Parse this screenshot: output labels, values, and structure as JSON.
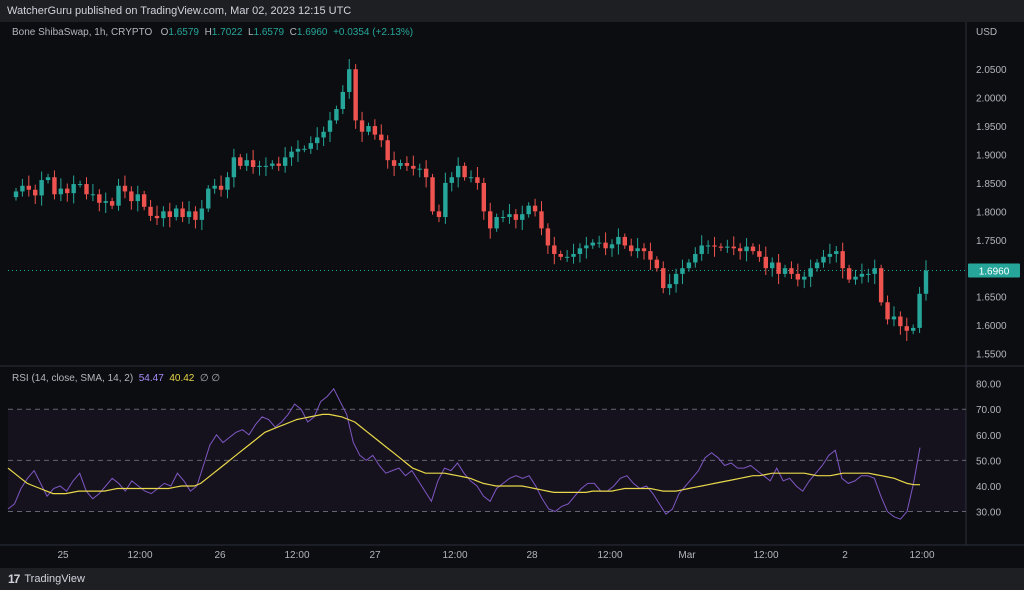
{
  "header": {
    "publisher": "WatcherGuru published on TradingView.com, Mar 02, 2023 12:15 UTC"
  },
  "legend": {
    "symbol": "Bone ShibaSwap, 1h, CRYPTO",
    "o_label": "O",
    "o": "1.6579",
    "h_label": "H",
    "h": "1.7022",
    "l_label": "L",
    "l": "1.6579",
    "c_label": "C",
    "c": "1.6960",
    "change": "+0.0354 (+2.13%)"
  },
  "rsi_legend": {
    "label": "RSI (14, close, SMA, 14, 2)",
    "rsi": "54.47",
    "sma": "40.42",
    "extra": "∅ ∅"
  },
  "footer": {
    "brand": "TradingView"
  },
  "colors": {
    "up": "#26a69a",
    "down": "#ef5350",
    "rsi": "#7e57c2",
    "rsi_ma": "#e8d84a",
    "price_tag": "#26a69a"
  },
  "chart_data": [
    {
      "type": "candlestick",
      "title": "Bone ShibaSwap, 1h, CRYPTO",
      "ylabel": "USD",
      "ylim": [
        1.535,
        2.075
      ],
      "y_ticks": [
        "2.0500",
        "2.0000",
        "1.9500",
        "1.9000",
        "1.8500",
        "1.8000",
        "1.7500",
        "1.7000",
        "1.6500",
        "1.6000",
        "1.5500"
      ],
      "x_ticks": [
        "25",
        "12:00",
        "26",
        "12:00",
        "27",
        "12:00",
        "28",
        "12:00",
        "Mar",
        "12:00",
        "2",
        "12:00"
      ],
      "last_price": "1.6960",
      "closes": [
        1.835,
        1.845,
        1.838,
        1.828,
        1.855,
        1.86,
        1.83,
        1.84,
        1.832,
        1.848,
        1.848,
        1.83,
        1.83,
        1.815,
        1.818,
        1.81,
        1.845,
        1.835,
        1.818,
        1.83,
        1.808,
        1.792,
        1.788,
        1.8,
        1.79,
        1.805,
        1.79,
        1.8,
        1.785,
        1.805,
        1.84,
        1.845,
        1.838,
        1.86,
        1.895,
        1.88,
        1.89,
        1.878,
        1.88,
        1.88,
        1.884,
        1.88,
        1.895,
        1.905,
        1.91,
        1.91,
        1.92,
        1.93,
        1.94,
        1.96,
        1.98,
        2.01,
        2.05,
        1.96,
        1.94,
        1.95,
        1.935,
        1.925,
        1.89,
        1.88,
        1.885,
        1.88,
        1.875,
        1.875,
        1.86,
        1.8,
        1.79,
        1.85,
        1.86,
        1.88,
        1.86,
        1.86,
        1.85,
        1.8,
        1.77,
        1.79,
        1.79,
        1.795,
        1.785,
        1.795,
        1.81,
        1.8,
        1.77,
        1.74,
        1.725,
        1.72,
        1.72,
        1.725,
        1.735,
        1.74,
        1.745,
        1.745,
        1.735,
        1.742,
        1.755,
        1.74,
        1.73,
        1.735,
        1.73,
        1.715,
        1.7,
        1.665,
        1.672,
        1.69,
        1.7,
        1.71,
        1.725,
        1.74,
        1.74,
        1.738,
        1.736,
        1.738,
        1.735,
        1.73,
        1.738,
        1.73,
        1.72,
        1.7,
        1.71,
        1.69,
        1.7,
        1.69,
        1.68,
        1.685,
        1.7,
        1.71,
        1.72,
        1.725,
        1.73,
        1.7,
        1.68,
        1.685,
        1.69,
        1.69,
        1.7,
        1.64,
        1.61,
        1.615,
        1.598,
        1.59,
        1.595,
        1.655,
        1.696
      ]
    },
    {
      "type": "line",
      "title": "RSI (14, close, SMA, 14, 2)",
      "ylim": [
        22,
        83
      ],
      "y_ticks": [
        "80.00",
        "70.00",
        "60.00",
        "50.00",
        "40.00",
        "30.00"
      ],
      "bands": [
        30,
        50,
        70
      ],
      "series": [
        {
          "name": "RSI",
          "values": [
            31,
            33,
            39,
            43,
            46,
            41,
            36,
            39,
            40,
            38,
            42,
            45,
            38,
            35,
            37,
            40,
            43,
            41,
            38,
            42,
            40,
            38,
            37,
            39,
            41,
            40,
            45,
            42,
            38,
            40,
            48,
            56,
            60,
            57,
            59,
            61,
            62,
            60,
            64,
            67,
            66,
            63,
            65,
            68,
            72,
            70,
            65,
            67,
            73,
            75,
            78,
            73,
            68,
            57,
            52,
            50,
            52,
            48,
            45,
            46,
            47,
            44,
            46,
            42,
            38,
            34,
            42,
            47,
            46,
            49,
            45,
            42,
            40,
            36,
            34,
            39,
            41,
            43,
            44,
            43,
            44,
            40,
            35,
            31,
            30,
            32,
            33,
            36,
            39,
            41,
            41,
            38,
            38,
            40,
            43,
            44,
            41,
            39,
            40,
            37,
            33,
            29,
            31,
            37,
            40,
            43,
            46,
            51,
            53,
            51,
            48,
            49,
            47,
            47,
            48,
            46,
            44,
            42,
            47,
            42,
            43,
            40,
            38,
            42,
            45,
            48,
            52,
            54,
            43,
            41,
            42,
            44,
            44,
            43,
            36,
            30,
            28,
            27,
            30,
            41,
            55
          ]
        },
        {
          "name": "SMA",
          "values": [
            47,
            45,
            43,
            41,
            40,
            39,
            38,
            37,
            37,
            37,
            37.5,
            38,
            38,
            38,
            38,
            38,
            38.5,
            39,
            39,
            39,
            39,
            39,
            39,
            39,
            39,
            39,
            39.5,
            40,
            40,
            40,
            41,
            43,
            45,
            47,
            49,
            51,
            53,
            55,
            57,
            59,
            61,
            62,
            63,
            64,
            65,
            66,
            66.5,
            67,
            67.5,
            68,
            68,
            67.5,
            67,
            66,
            65,
            63,
            61,
            59,
            57,
            55,
            53,
            51,
            49,
            47,
            46,
            45,
            45,
            45,
            45,
            44.5,
            44,
            43.5,
            43,
            42,
            41,
            40.5,
            40,
            40,
            40,
            40,
            40,
            39.5,
            39,
            38.5,
            38,
            37.5,
            37.5,
            37.5,
            37.5,
            37.5,
            37.5,
            38,
            38,
            38,
            38,
            38.5,
            39,
            39,
            39,
            39,
            39,
            38.5,
            38,
            38,
            38,
            38.5,
            39,
            39.5,
            40,
            40.5,
            41,
            41.5,
            42,
            42.5,
            43,
            43.5,
            44,
            44,
            44.5,
            45,
            45,
            45,
            45,
            45,
            45,
            44.5,
            44,
            44,
            44,
            44.5,
            45,
            45,
            45,
            45,
            45,
            44.5,
            44,
            43.5,
            43,
            42,
            41,
            40.5,
            40.5
          ]
        }
      ]
    }
  ]
}
